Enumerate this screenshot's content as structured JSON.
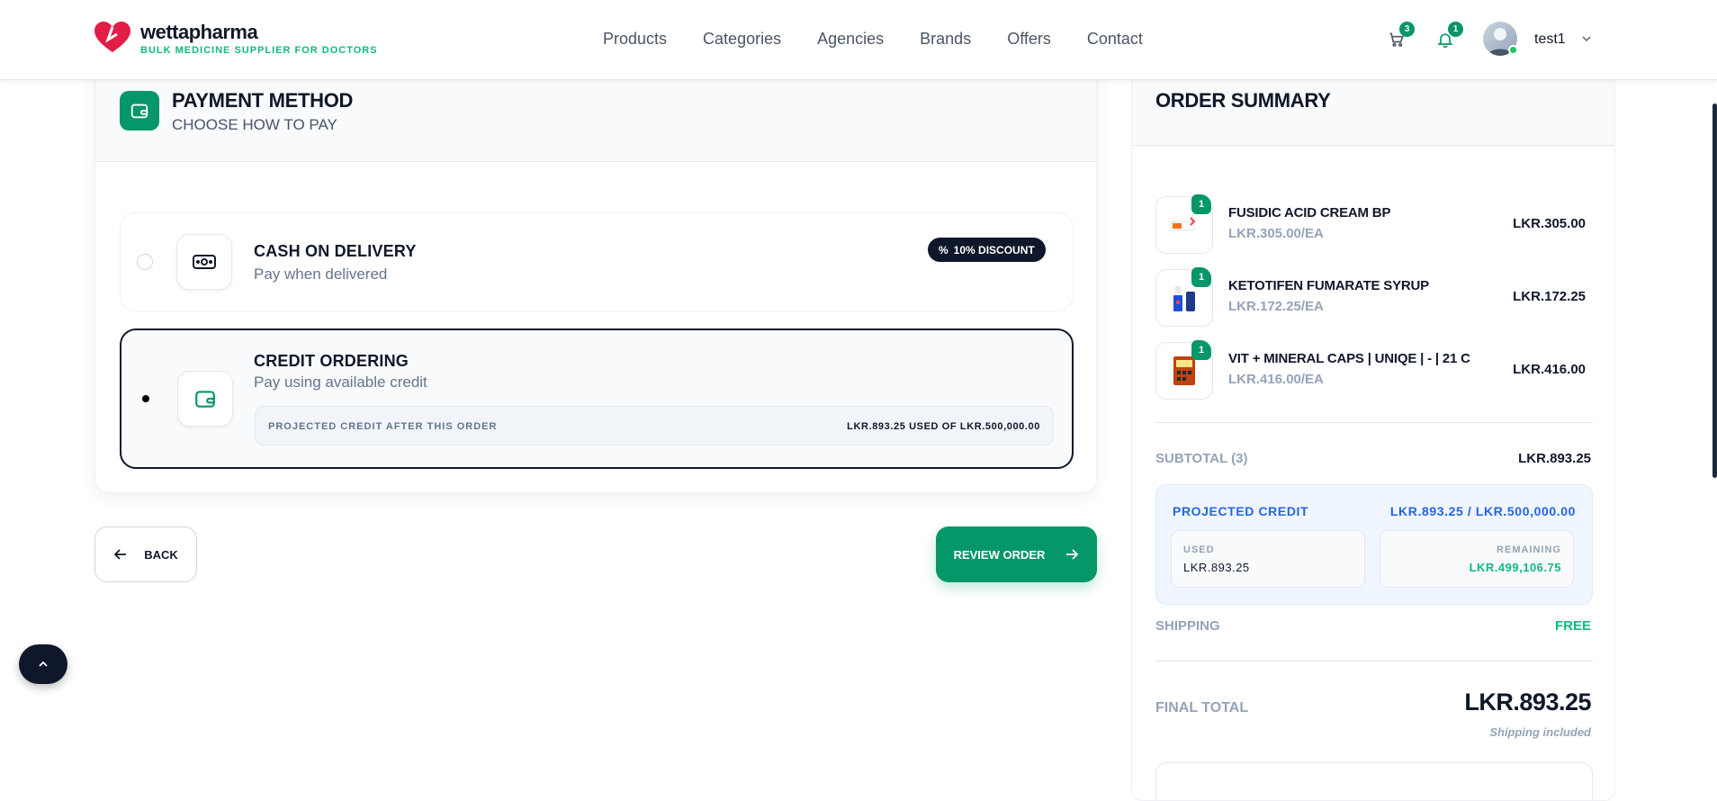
{
  "brand": {
    "name": "wettapharma",
    "tagline": "BULK MEDICINE SUPPLIER FOR DOCTORS",
    "accent": "#059669",
    "logo_color": "#e11d48"
  },
  "nav": [
    {
      "label": "Products"
    },
    {
      "label": "Categories"
    },
    {
      "label": "Agencies"
    },
    {
      "label": "Brands"
    },
    {
      "label": "Offers"
    },
    {
      "label": "Contact"
    }
  ],
  "header": {
    "cart_count": "3",
    "notification_count": "1",
    "username": "test1"
  },
  "payment": {
    "title": "PAYMENT METHOD",
    "subtitle": "CHOOSE HOW TO PAY",
    "options": [
      {
        "title": "CASH ON DELIVERY",
        "subtitle": "Pay when delivered",
        "badge": "10% DISCOUNT",
        "selected": false,
        "icon": "cash-icon"
      },
      {
        "title": "CREDIT ORDERING",
        "subtitle": "Pay using available credit",
        "selected": true,
        "icon": "wallet-icon",
        "projected_label": "PROJECTED CREDIT AFTER THIS ORDER",
        "projected_value": "LKR.893.25 USED OF LKR.500,000.00"
      }
    ]
  },
  "actions": {
    "back": "BACK",
    "review": "REVIEW ORDER"
  },
  "summary": {
    "title": "ORDER SUMMARY",
    "items": [
      {
        "name": "FUSIDIC ACID CREAM BP",
        "unit_price": "LKR.305.00/EA",
        "price": "LKR.305.00",
        "qty": "1"
      },
      {
        "name": "KETOTIFEN FUMARATE SYRUP",
        "unit_price": "LKR.172.25/EA",
        "price": "LKR.172.25",
        "qty": "1"
      },
      {
        "name": "VIT + MINERAL CAPS | UNIQE | - | 21 C",
        "unit_price": "LKR.416.00/EA",
        "price": "LKR.416.00",
        "qty": "1"
      }
    ],
    "subtotal_label": "SUBTOTAL (3)",
    "subtotal": "LKR.893.25",
    "credit": {
      "label": "PROJECTED CREDIT",
      "value": "LKR.893.25 / LKR.500,000.00",
      "used_label": "USED",
      "used": "LKR.893.25",
      "remaining_label": "REMAINING",
      "remaining": "LKR.499,106.75"
    },
    "shipping_label": "SHIPPING",
    "shipping": "FREE",
    "final_label": "FINAL TOTAL",
    "final_total": "LKR.893.25",
    "shipping_note": "Shipping included"
  }
}
